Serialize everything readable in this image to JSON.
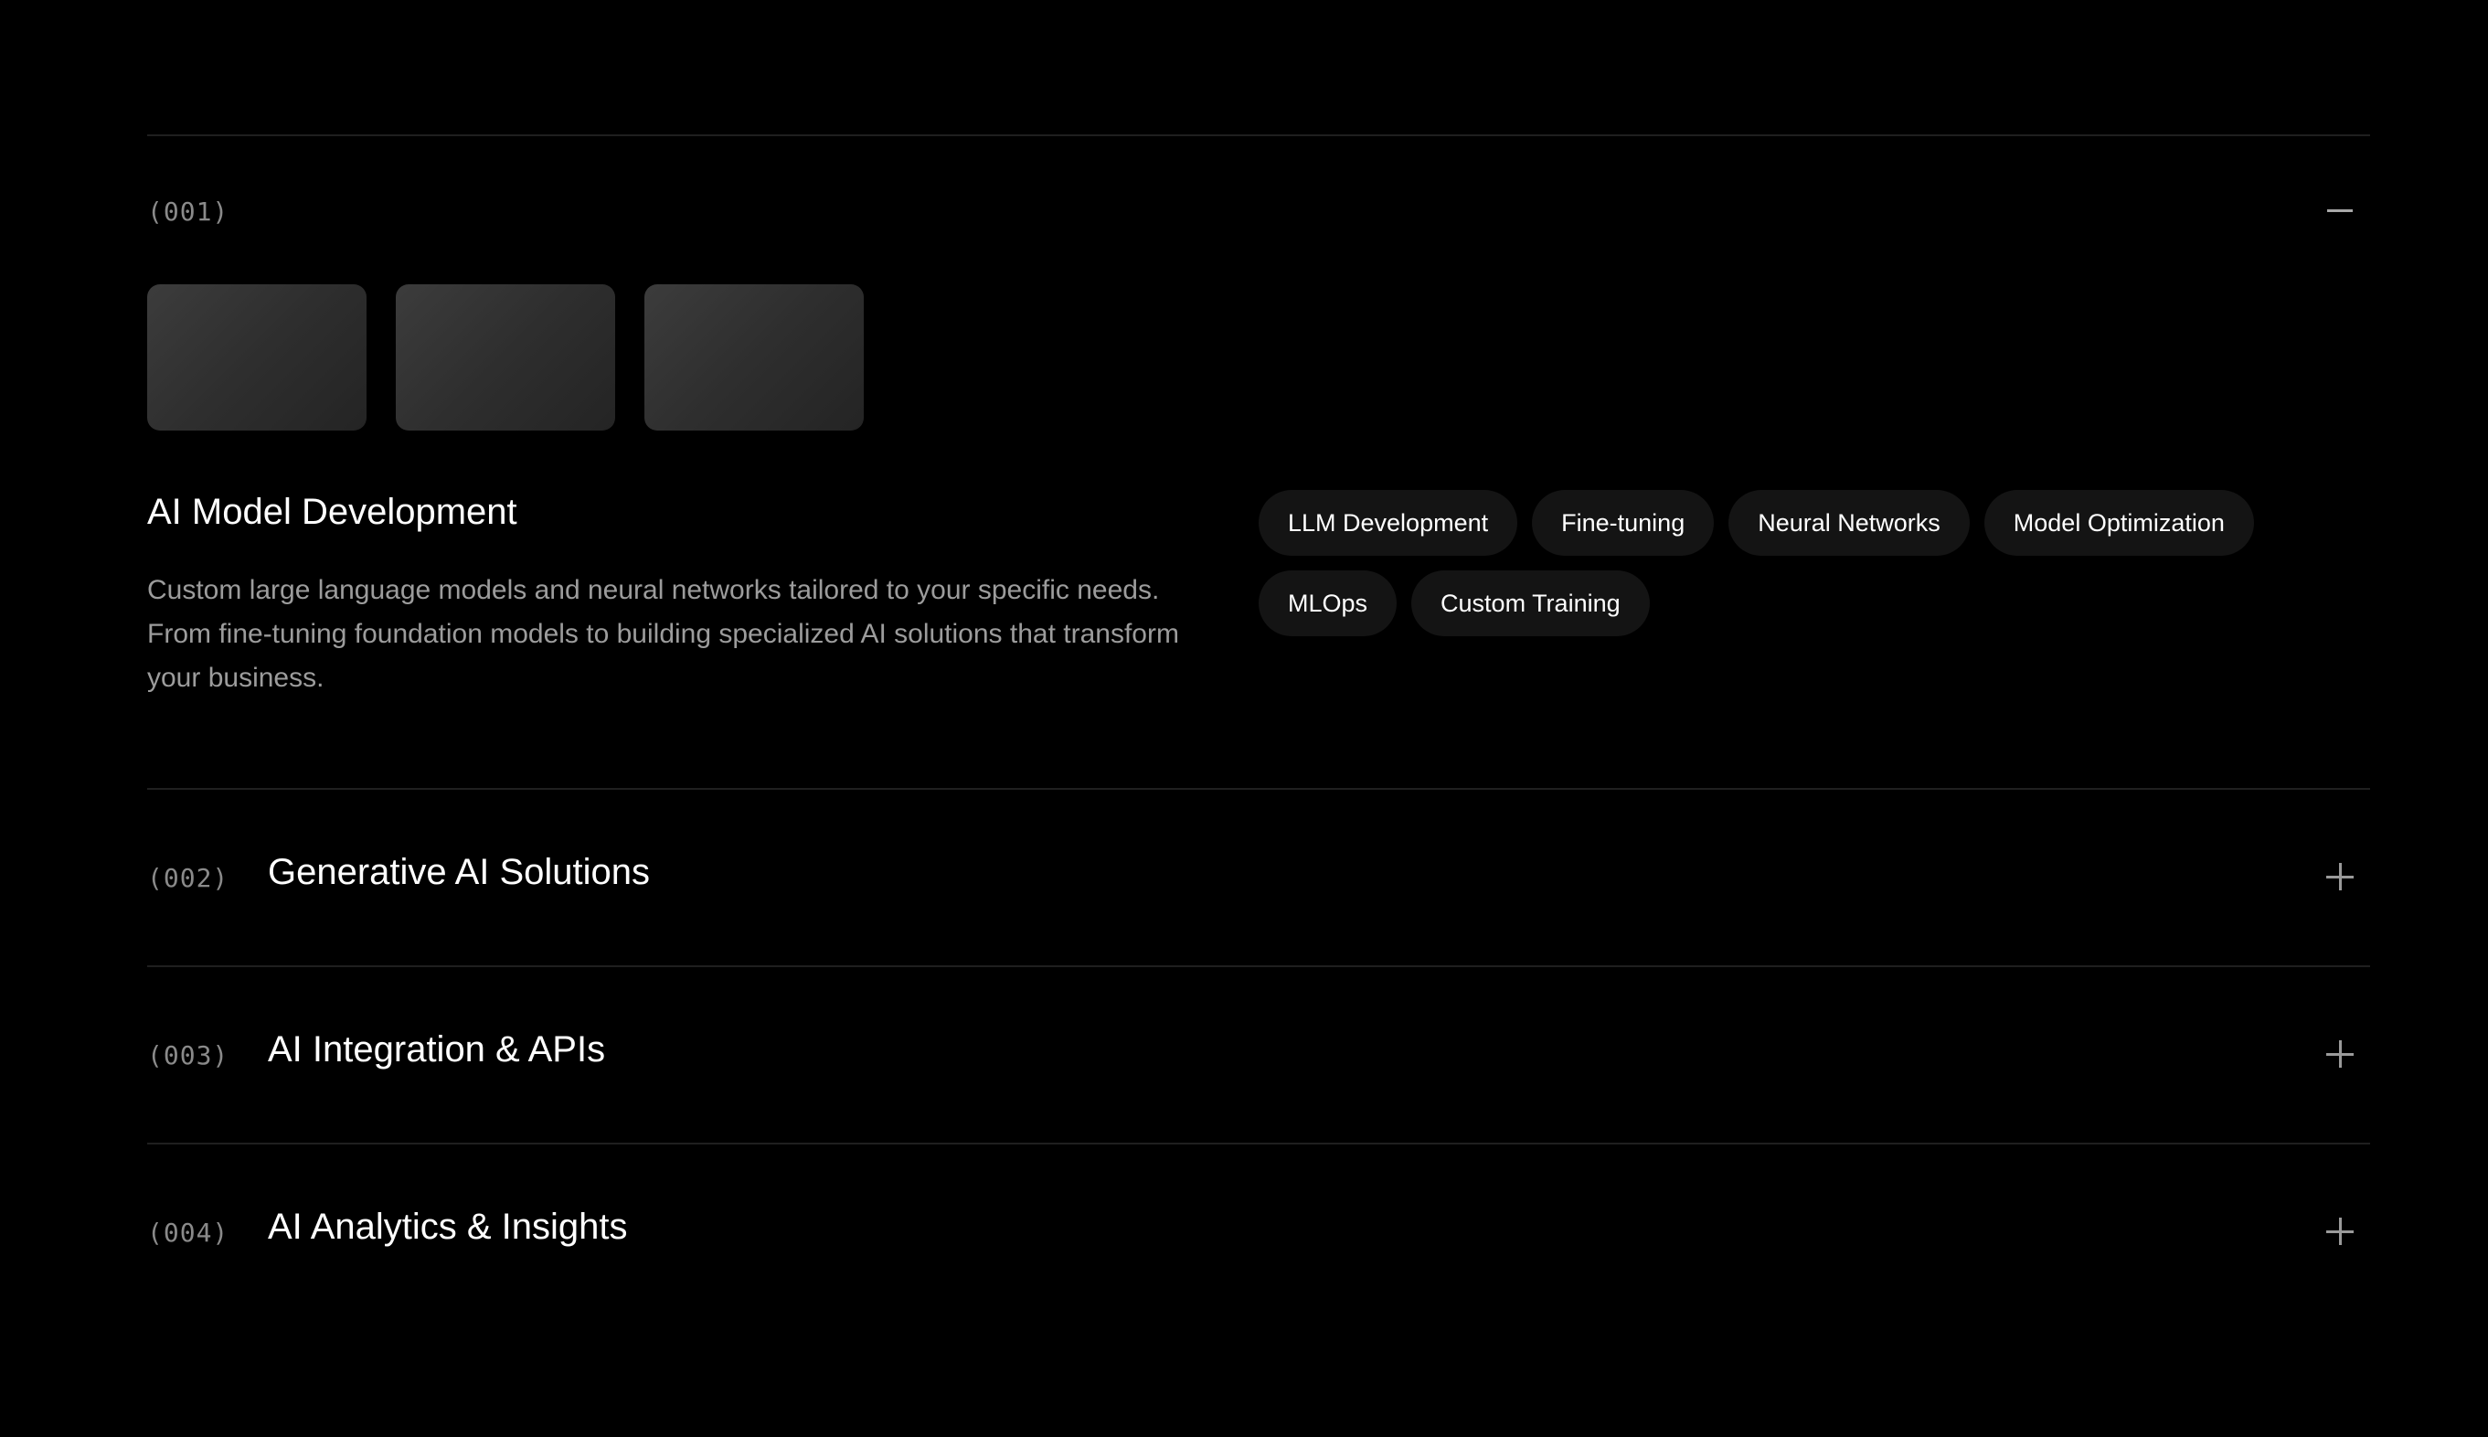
{
  "services": {
    "items": [
      {
        "index": "(001)",
        "title": "AI Model Development",
        "expanded": true,
        "toggle_icon": "minus-icon",
        "description": "Custom large language models and neural networks tailored to your specific needs. From fine-tuning foundation models to building specialized AI solutions that transform your business.",
        "tags": [
          "LLM Development",
          "Fine-tuning",
          "Neural Networks",
          "Model Optimization",
          "MLOps",
          "Custom Training"
        ]
      },
      {
        "index": "(002)",
        "title": "Generative AI Solutions",
        "expanded": false,
        "toggle_icon": "plus-icon"
      },
      {
        "index": "(003)",
        "title": "AI Integration & APIs",
        "expanded": false,
        "toggle_icon": "plus-icon"
      },
      {
        "index": "(004)",
        "title": "AI Analytics & Insights",
        "expanded": false,
        "toggle_icon": "plus-icon"
      }
    ]
  },
  "colors": {
    "background": "#000000",
    "divider": "#1f1f1f",
    "tag_bg": "#141414",
    "muted_text": "#9c9c9c"
  }
}
